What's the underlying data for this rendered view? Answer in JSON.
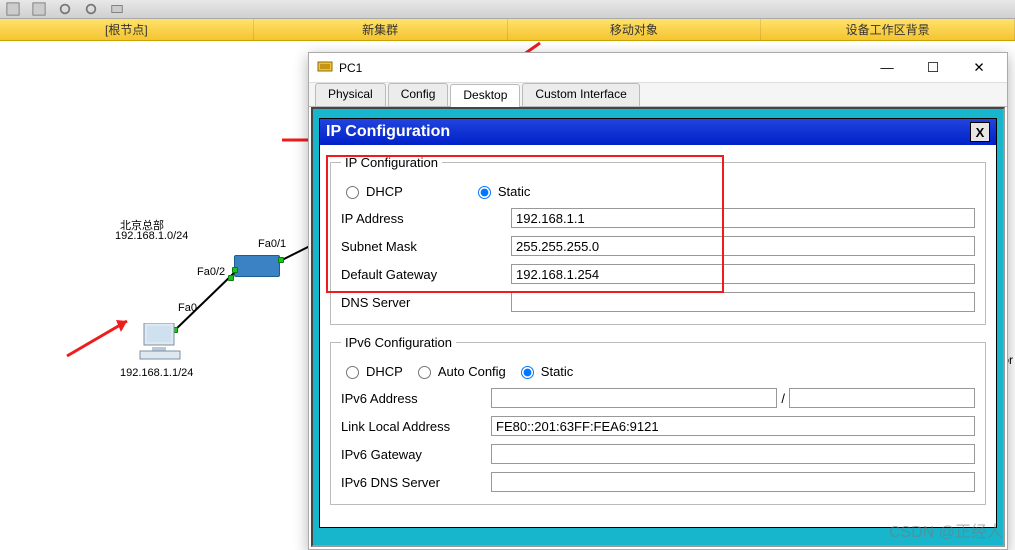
{
  "main_toolbar": {
    "buttons": {
      "root_node": "[根节点]",
      "new_cluster": "新集群",
      "move_object": "移动对象",
      "device_workspace_bg": "设备工作区背景"
    }
  },
  "topology": {
    "site_label": "北京总部",
    "site_cidr": "192.168.1.0/24",
    "pc_label": "192.168.1.1/24",
    "iface1": "Fa0/1",
    "iface2": "Fa0/2",
    "iface3": "Fa0"
  },
  "window": {
    "title": "PC1",
    "tabs": [
      "Physical",
      "Config",
      "Desktop",
      "Custom Interface"
    ],
    "active_tab": 2
  },
  "ipcfg": {
    "title": "IP Configuration",
    "close": "X",
    "group_v4": "IP Configuration",
    "opt_dhcp": "DHCP",
    "opt_static": "Static",
    "v4_selected": "static",
    "lbl_ip": "IP Address",
    "lbl_mask": "Subnet Mask",
    "lbl_gw": "Default Gateway",
    "lbl_dns": "DNS Server",
    "val_ip": "192.168.1.1",
    "val_mask": "255.255.255.0",
    "val_gw": "192.168.1.254",
    "val_dns": "",
    "group_v6": "IPv6 Configuration",
    "opt_auto": "Auto Config",
    "v6_selected": "static",
    "lbl_v6addr": "IPv6 Address",
    "lbl_linklocal": "Link Local Address",
    "lbl_v6gw": "IPv6 Gateway",
    "lbl_v6dns": "IPv6 DNS Server",
    "val_v6addr": "",
    "val_v6prefix": "",
    "val_linklocal": "FE80::201:63FF:FEA6:9121",
    "val_v6gw": "",
    "val_v6dns": "",
    "slash": "/"
  },
  "edge_label": "or",
  "watermark": "CSDN @正经人"
}
